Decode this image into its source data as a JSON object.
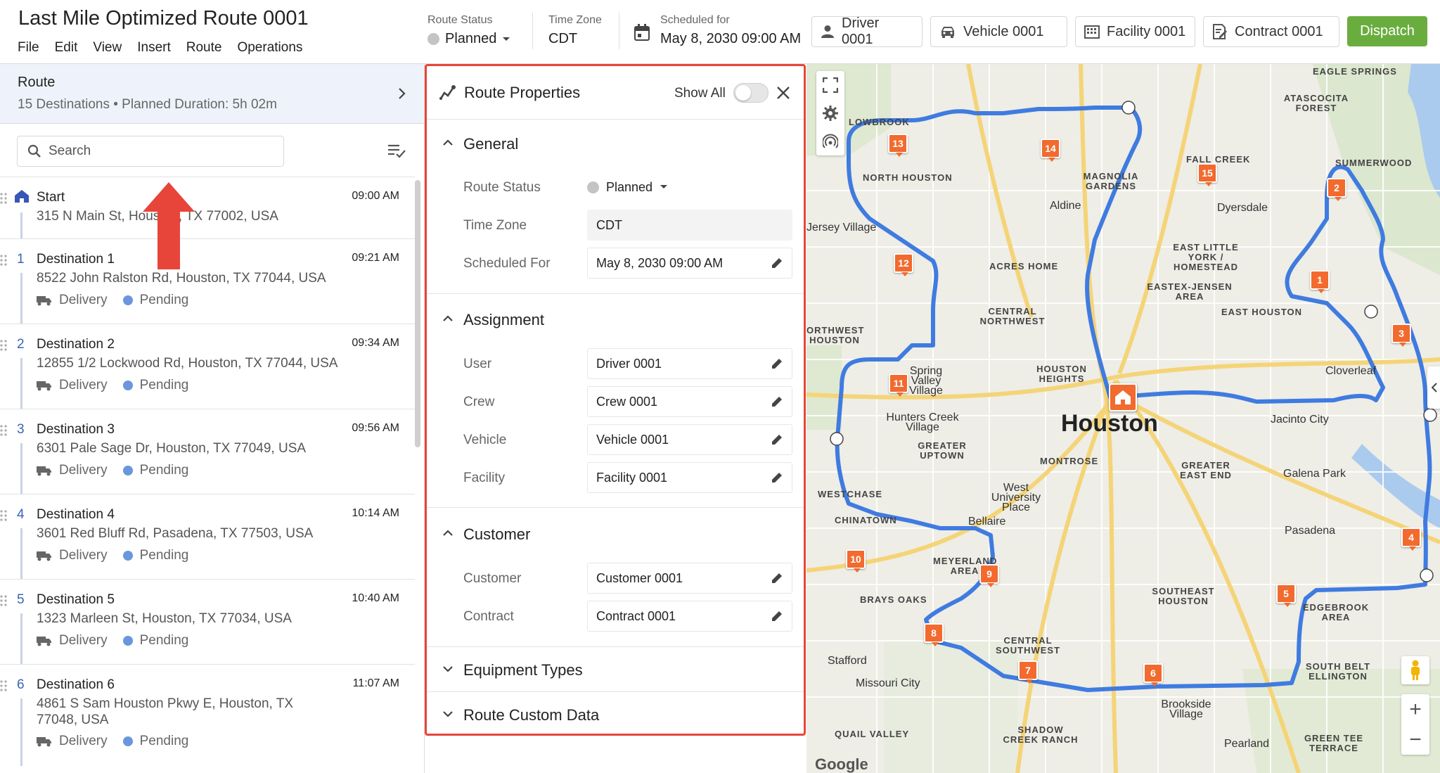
{
  "header": {
    "title": "Last Mile Optimized Route 0001",
    "menu": [
      "File",
      "Edit",
      "View",
      "Insert",
      "Route",
      "Operations"
    ],
    "route_status": {
      "label": "Route Status",
      "value": "Planned"
    },
    "time_zone": {
      "label": "Time Zone",
      "value": "CDT"
    },
    "scheduled": {
      "label": "Scheduled for",
      "value": "May 8, 2030  09:00 AM"
    },
    "buttons": {
      "driver": "Driver 0001",
      "vehicle": "Vehicle 0001",
      "facility": "Facility 0001",
      "contract": "Contract 0001",
      "dispatch": "Dispatch"
    }
  },
  "route_summary": {
    "title": "Route",
    "subtitle": "15 Destinations • Planned Duration: 5h 02m"
  },
  "search": {
    "placeholder": "Search"
  },
  "stops": [
    {
      "number": "",
      "name": "Start",
      "time": "09:00 AM",
      "address": "315 N Main St, Houston, TX 77002, USA",
      "type": "",
      "status": ""
    },
    {
      "number": "1",
      "name": "Destination 1",
      "time": "09:21 AM",
      "address": "8522 John Ralston Rd, Houston, TX 77044, USA",
      "type": "Delivery",
      "status": "Pending"
    },
    {
      "number": "2",
      "name": "Destination 2",
      "time": "09:34 AM",
      "address": "12855 1/2 Lockwood Rd, Houston, TX 77044, USA",
      "type": "Delivery",
      "status": "Pending"
    },
    {
      "number": "3",
      "name": "Destination 3",
      "time": "09:56 AM",
      "address": "6301 Pale Sage Dr, Houston, TX 77049, USA",
      "type": "Delivery",
      "status": "Pending"
    },
    {
      "number": "4",
      "name": "Destination 4",
      "time": "10:14 AM",
      "address": "3601 Red Bluff Rd, Pasadena, TX 77503, USA",
      "type": "Delivery",
      "status": "Pending"
    },
    {
      "number": "5",
      "name": "Destination 5",
      "time": "10:40 AM",
      "address": "1323 Marleen St, Houston, TX 77034, USA",
      "type": "Delivery",
      "status": "Pending"
    },
    {
      "number": "6",
      "name": "Destination 6",
      "time": "11:07 AM",
      "address": "4861 S Sam Houston Pkwy E, Houston, TX 77048, USA",
      "type": "Delivery",
      "status": "Pending"
    }
  ],
  "properties": {
    "title": "Route Properties",
    "show_all": "Show All",
    "general": {
      "title": "General",
      "route_status_label": "Route Status",
      "route_status_value": "Planned",
      "time_zone_label": "Time Zone",
      "time_zone_value": "CDT",
      "scheduled_label": "Scheduled For",
      "scheduled_value": "May 8, 2030  09:00 AM"
    },
    "assignment": {
      "title": "Assignment",
      "user_label": "User",
      "user_value": "Driver 0001",
      "crew_label": "Crew",
      "crew_value": "Crew 0001",
      "vehicle_label": "Vehicle",
      "vehicle_value": "Vehicle 0001",
      "facility_label": "Facility",
      "facility_value": "Facility 0001"
    },
    "customer": {
      "title": "Customer",
      "customer_label": "Customer",
      "customer_value": "Customer 0001",
      "contract_label": "Contract",
      "contract_value": "Contract 0001"
    },
    "equipment_title": "Equipment Types",
    "custom_data_title": "Route Custom Data"
  },
  "map": {
    "city": "Houston",
    "labels": {
      "eagle_springs": "Eagle Springs",
      "atascocita": "Atascocita Forest",
      "fall_creek": "Fall Creek",
      "summerwood": "Summerwood",
      "magnolia": "Magnolia Gardens",
      "aldine": "Aldine",
      "dyersdale": "Dyersdale",
      "north_houston": "North Houston",
      "acres_home": "Acres Home",
      "east_little_york": "East Little York / Homestead",
      "eastex": "Eastex-Jensen Area",
      "east_houston": "East Houston",
      "central_northwest": "Central Northwest",
      "houston_heights": "Houston Heights",
      "cloverleaf": "Cloverleaf",
      "spring_valley": "Spring Valley Village",
      "hunters_creek": "Hunters Creek Village",
      "greater_uptown": "Greater Uptown",
      "jacinto_city": "Jacinto City",
      "montrose": "Montrose",
      "galena_park": "Galena Park",
      "greater_east_end": "Greater East End",
      "west_university": "West University Place",
      "bellaire": "Bellaire",
      "pasadena": "Pasadena",
      "chinatown": "Chinatown",
      "westchase": "Westchase",
      "meyerland": "Meyerland Area",
      "brays_oaks": "Brays Oaks",
      "southeast_houston": "Southeast Houston",
      "edgebrook": "Edgebrook Area",
      "central_southwest": "Central Southwest",
      "stafford": "Stafford",
      "missouri_city": "Missouri City",
      "south_belt": "South Belt Ellington",
      "brookside": "Brookside Village",
      "quail_valley": "Quail Valley",
      "shadow_creek": "Shadow Creek Ranch",
      "pearland": "Pearland",
      "green_tee": "Green Tee Terrace",
      "northwest_houston": "Orthwest Houston",
      "lowbrook": "Lowbrook",
      "jersey_village": "Jersey Village",
      "google": "Google"
    },
    "markers": [
      "1",
      "2",
      "3",
      "4",
      "5",
      "6",
      "7",
      "8",
      "9",
      "10",
      "11",
      "12",
      "13",
      "14",
      "15"
    ]
  },
  "colors": {
    "accent": "#6aad3f",
    "route": "#3f7be0",
    "marker": "#f26a2e",
    "highlight": "#e8453a"
  }
}
